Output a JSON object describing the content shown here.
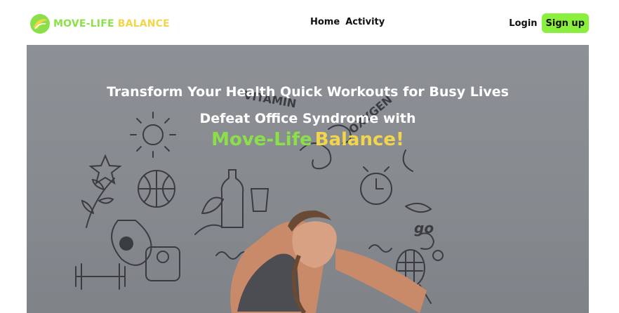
{
  "header": {
    "logo": {
      "text_primary": "MOVE-LIFE",
      "text_secondary": "BALANCE",
      "icon": "leaf-swirl-icon",
      "primary_color": "#8be04a",
      "secondary_color": "#f2d54a"
    },
    "nav": [
      {
        "label": "Home"
      },
      {
        "label": "Activity"
      }
    ],
    "login_label": "Login",
    "signup_label": "Sign up",
    "signup_color": "#8bef3e"
  },
  "hero": {
    "line1": "Transform Your Health Quick Workouts for Busy Lives",
    "line2": "Defeat Office Syndrome with",
    "brand_primary": "Move-Life",
    "brand_secondary": "Balance!",
    "image": "woman-exercising-with-doodle-background"
  }
}
